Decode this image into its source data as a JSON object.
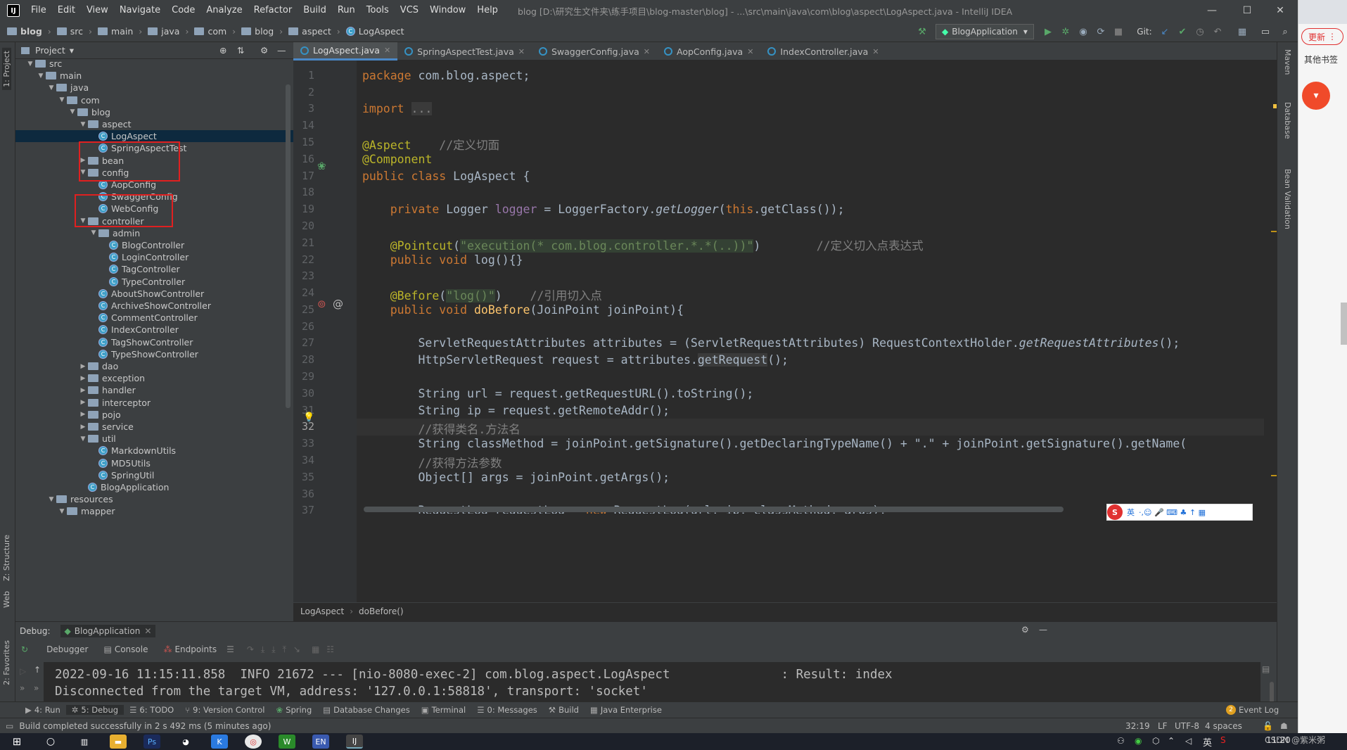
{
  "app": {
    "logo": "IJ",
    "menus": [
      "File",
      "Edit",
      "View",
      "Navigate",
      "Code",
      "Analyze",
      "Refactor",
      "Build",
      "Run",
      "Tools",
      "VCS",
      "Window",
      "Help"
    ],
    "window_title": "blog [D:\\研究生文件夹\\练手项目\\blog-master\\blog] - ...\\src\\main\\java\\com\\blog\\aspect\\LogAspect.java - IntelliJ IDEA",
    "win_controls": [
      "—",
      "☐",
      "✕"
    ]
  },
  "navbar": {
    "crumbs": [
      "blog",
      "src",
      "main",
      "java",
      "com",
      "blog",
      "aspect",
      "LogAspect"
    ],
    "run_config": "BlogApplication",
    "git_label": "Git:"
  },
  "left_strip": {
    "project": "1: Project",
    "structure": "Z: Structure",
    "web": "Web",
    "favorites": "2: Favorites"
  },
  "right_strip": {
    "maven": "Maven",
    "database": "Database",
    "bean_validation": "Bean Validation"
  },
  "project_panel": {
    "title": "Project",
    "tree": [
      {
        "label": "src",
        "depth": 0,
        "kind": "folder",
        "arrow": "▼"
      },
      {
        "label": "main",
        "depth": 1,
        "kind": "folder",
        "arrow": "▼"
      },
      {
        "label": "java",
        "depth": 2,
        "kind": "folder",
        "arrow": "▼"
      },
      {
        "label": "com",
        "depth": 3,
        "kind": "folder",
        "arrow": "▼"
      },
      {
        "label": "blog",
        "depth": 4,
        "kind": "folder",
        "arrow": "▼"
      },
      {
        "label": "aspect",
        "depth": 5,
        "kind": "folder",
        "arrow": "▼"
      },
      {
        "label": "LogAspect",
        "depth": 6,
        "kind": "class",
        "arrow": "",
        "selected": true
      },
      {
        "label": "SpringAspectTest",
        "depth": 6,
        "kind": "class",
        "arrow": ""
      },
      {
        "label": "bean",
        "depth": 5,
        "kind": "folder",
        "arrow": "▶"
      },
      {
        "label": "config",
        "depth": 5,
        "kind": "folder",
        "arrow": "▼"
      },
      {
        "label": "AopConfig",
        "depth": 6,
        "kind": "class",
        "arrow": ""
      },
      {
        "label": "SwaggerConfig",
        "depth": 6,
        "kind": "class",
        "arrow": ""
      },
      {
        "label": "WebConfig",
        "depth": 6,
        "kind": "class",
        "arrow": ""
      },
      {
        "label": "controller",
        "depth": 5,
        "kind": "folder",
        "arrow": "▼"
      },
      {
        "label": "admin",
        "depth": 6,
        "kind": "folder",
        "arrow": "▼"
      },
      {
        "label": "BlogController",
        "depth": 7,
        "kind": "class",
        "arrow": ""
      },
      {
        "label": "LoginController",
        "depth": 7,
        "kind": "class",
        "arrow": ""
      },
      {
        "label": "TagController",
        "depth": 7,
        "kind": "class",
        "arrow": ""
      },
      {
        "label": "TypeController",
        "depth": 7,
        "kind": "class",
        "arrow": ""
      },
      {
        "label": "AboutShowController",
        "depth": 6,
        "kind": "class",
        "arrow": ""
      },
      {
        "label": "ArchiveShowController",
        "depth": 6,
        "kind": "class",
        "arrow": ""
      },
      {
        "label": "CommentController",
        "depth": 6,
        "kind": "class",
        "arrow": ""
      },
      {
        "label": "IndexController",
        "depth": 6,
        "kind": "class",
        "arrow": ""
      },
      {
        "label": "TagShowController",
        "depth": 6,
        "kind": "class",
        "arrow": ""
      },
      {
        "label": "TypeShowController",
        "depth": 6,
        "kind": "class",
        "arrow": ""
      },
      {
        "label": "dao",
        "depth": 5,
        "kind": "folder",
        "arrow": "▶"
      },
      {
        "label": "exception",
        "depth": 5,
        "kind": "folder",
        "arrow": "▶"
      },
      {
        "label": "handler",
        "depth": 5,
        "kind": "folder",
        "arrow": "▶"
      },
      {
        "label": "interceptor",
        "depth": 5,
        "kind": "folder",
        "arrow": "▶"
      },
      {
        "label": "pojo",
        "depth": 5,
        "kind": "folder",
        "arrow": "▶"
      },
      {
        "label": "service",
        "depth": 5,
        "kind": "folder",
        "arrow": "▶"
      },
      {
        "label": "util",
        "depth": 5,
        "kind": "folder",
        "arrow": "▼"
      },
      {
        "label": "MarkdownUtils",
        "depth": 6,
        "kind": "class",
        "arrow": ""
      },
      {
        "label": "MD5Utils",
        "depth": 6,
        "kind": "class",
        "arrow": ""
      },
      {
        "label": "SpringUtil",
        "depth": 6,
        "kind": "class",
        "arrow": ""
      },
      {
        "label": "BlogApplication",
        "depth": 5,
        "kind": "class",
        "arrow": ""
      },
      {
        "label": "resources",
        "depth": 2,
        "kind": "folder",
        "arrow": "▼"
      },
      {
        "label": "mapper",
        "depth": 3,
        "kind": "folder",
        "arrow": "▼"
      }
    ]
  },
  "editor": {
    "tabs": [
      {
        "label": "LogAspect.java",
        "active": true
      },
      {
        "label": "SpringAspectTest.java",
        "active": false
      },
      {
        "label": "SwaggerConfig.java",
        "active": false
      },
      {
        "label": "AopConfig.java",
        "active": false
      },
      {
        "label": "IndexController.java",
        "active": false
      }
    ],
    "line_numbers": [
      "1",
      "2",
      "3",
      "14",
      "15",
      "16",
      "17",
      "18",
      "19",
      "20",
      "21",
      "22",
      "23",
      "24",
      "25",
      "26",
      "27",
      "28",
      "29",
      "30",
      "31",
      "32",
      "33",
      "34",
      "35",
      "36",
      "37"
    ],
    "current_line": "32",
    "code": {
      "l1_kw": "package",
      "l1_rest": " com.blog.aspect;",
      "l3_kw": "import",
      "l3_dots": "...",
      "l15_ann": "@Aspect",
      "l15_cm": "//定义切面",
      "l16_ann": "@Component",
      "l17_kw": "public class",
      "l17_rest": " LogAspect {",
      "l19_kw": "private",
      "l19_a": " Logger ",
      "l19_field": "logger",
      "l19_b": " = LoggerFactory.",
      "l19_it": "getLogger",
      "l19_c": "(",
      "l19_this": "this",
      "l19_d": ".getClass());",
      "l21_ann": "@Pointcut",
      "l21_a": "(",
      "l21_str": "\"execution(* com.blog.controller.*.*(..))\"",
      "l21_b": ")",
      "l21_cm": "//定义切入点表达式",
      "l22_kw": "public void",
      "l22_rest": " log(){}",
      "l24_ann": "@Before",
      "l24_a": "(",
      "l24_str": "\"log()\"",
      "l24_b": ")",
      "l24_cm": "//引用切入点",
      "l25_kw": "public void",
      "l25_fn": "doBefore",
      "l25_rest": "(JoinPoint joinPoint){",
      "l27_a": "ServletRequestAttributes attributes = (ServletRequestAttributes) RequestContextHolder.",
      "l27_it": "getRequestAttributes",
      "l27_b": "();",
      "l28_a": "HttpServletRequest request = attributes.",
      "l28_hl": "getRequest",
      "l28_b": "();",
      "l30": "String url = request.getRequestURL().toString();",
      "l31": "String ip = request.getRemoteAddr();",
      "l32_cm": "//获得类名.方法名",
      "l33": "String classMethod = joinPoint.getSignature().getDeclaringTypeName() + \".\" + joinPoint.getSignature().getName(",
      "l34_cm": "//获得方法参数",
      "l35": "Object[] args = joinPoint.getArgs();",
      "l37_a": "RequestLog requestLog = ",
      "l37_kw": "new",
      "l37_b": " RequestLog(url, ip, classMethod, args);"
    },
    "breadcrumb": [
      "LogAspect",
      "doBefore()"
    ]
  },
  "ime_bar": {
    "label": "英"
  },
  "debug": {
    "title": "Debug:",
    "session": "BlogApplication",
    "tabs": [
      "Debugger",
      "Console",
      "Endpoints"
    ],
    "console_lines": [
      "2022-09-16 11:15:11.858  INFO 21672 --- [nio-8080-exec-2] com.blog.aspect.LogAspect               : Result: index",
      "Disconnected from the target VM, address: '127.0.0.1:58818', transport: 'socket'"
    ]
  },
  "bottom_tabs": [
    "4: Run",
    "5: Debug",
    "6: TODO",
    "9: Version Control",
    "Spring",
    "Database Changes",
    "Terminal",
    "0: Messages",
    "Build",
    "Java Enterprise"
  ],
  "event_log": {
    "count": "2",
    "label": "Event Log"
  },
  "status": {
    "message": "Build completed successfully in 2 s 492 ms (5 minutes ago)",
    "position": "32:19",
    "line_sep": "LF",
    "encoding": "UTF-8",
    "indent": "4 spaces"
  },
  "browser": {
    "update_btn": "更新",
    "bookmarks": "其他书签"
  },
  "taskbar": {
    "time": "11:20",
    "watermark": "CSDN @紫米粥",
    "lang": "英"
  },
  "colors": {
    "accent": "#4a88c7",
    "keyword": "#cc7832",
    "annotation": "#bbb529",
    "string": "#6a8759",
    "comment": "#808080",
    "redbox": "#e02020"
  }
}
